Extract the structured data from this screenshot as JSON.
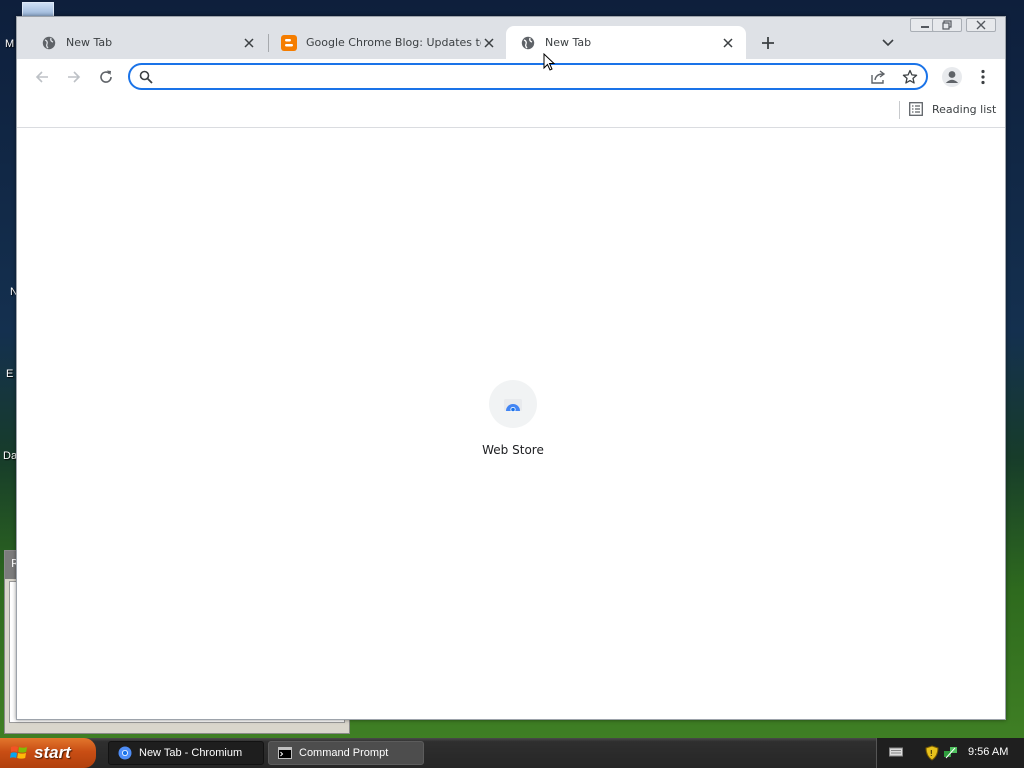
{
  "desktop": {
    "icon_labels": [
      "M",
      "N",
      "E",
      "Da"
    ],
    "behind_window_title": "R"
  },
  "window": {
    "controls": [
      "minimize",
      "maximize",
      "close"
    ]
  },
  "tabs": [
    {
      "title": "New Tab",
      "icon": "globe-icon",
      "active": false
    },
    {
      "title": "Google Chrome Blog: Updates to Chr",
      "icon": "blogger-icon",
      "active": false
    },
    {
      "title": "New Tab",
      "icon": "globe-icon",
      "active": true
    }
  ],
  "omnibox": {
    "value": "",
    "placeholder": ""
  },
  "bookmarks_bar": {
    "reading_list_label": "Reading list"
  },
  "ntp": {
    "shortcuts": [
      {
        "label": "Web Store",
        "icon": "web-store-icon"
      }
    ]
  },
  "taskbar": {
    "start_label": "start",
    "tasks": [
      {
        "label": "New Tab - Chromium",
        "icon": "chromium-icon",
        "active": true
      },
      {
        "label": "Command Prompt",
        "icon": "cmd-icon",
        "active": false
      }
    ],
    "clock": "9:56 AM"
  },
  "colors": {
    "accent": "#1a73e8",
    "tabstrip": "#dee1e6",
    "start_button": "#c94e14"
  }
}
